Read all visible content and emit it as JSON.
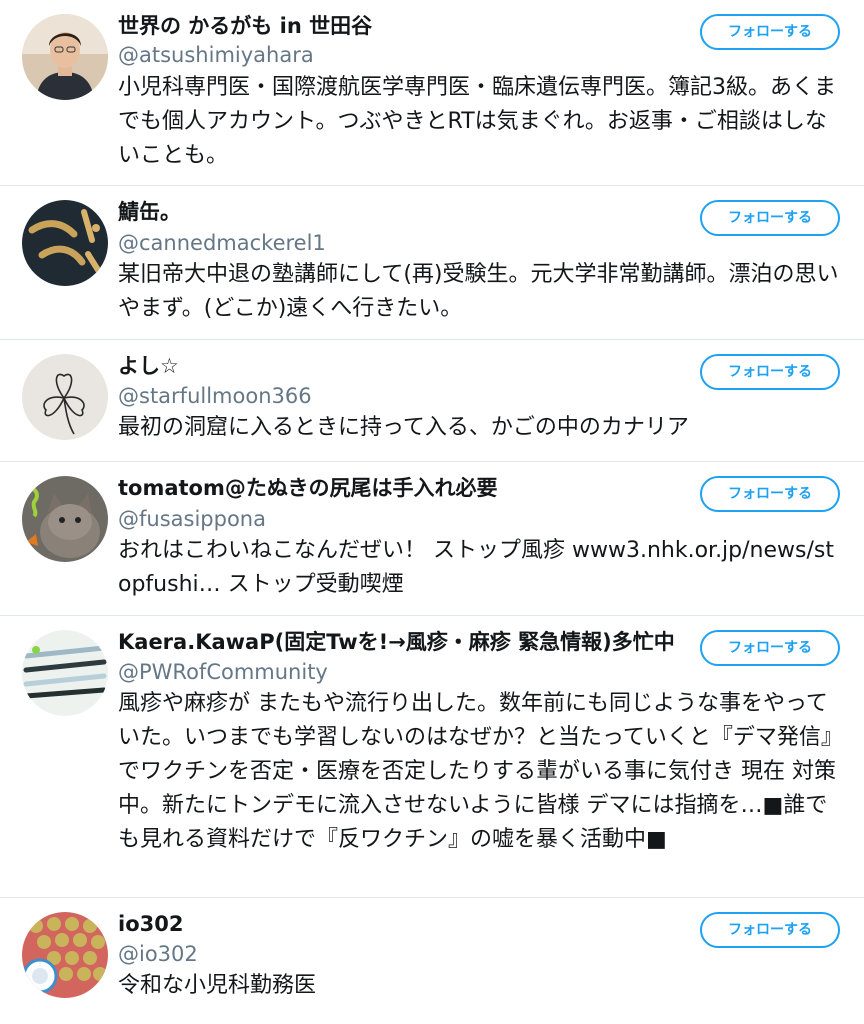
{
  "follow_label": "フォローする",
  "accent_color": "#1da1f2",
  "users": [
    {
      "name": "世界の かるがも in 世田谷",
      "handle": "@atsushimiyahara",
      "bio": "小児科専門医・国際渡航医学専門医・臨床遺伝専門医。簿記3級。あくまでも個人アカウント。つぶやきとRTは気まぐれ。お返事・ご相談はしないことも。",
      "avatar": "person-photo"
    },
    {
      "name": "鯖缶。",
      "handle": "@cannedmackerel1",
      "bio": "某旧帝大中退の塾講師にして(再)受験生。元大学非常勤講師。漂泊の思いやまず。(どこか)遠くへ行きたい。",
      "avatar": "calligraphy-image"
    },
    {
      "name": "よし☆",
      "handle": "@starfullmoon366",
      "bio": "最初の洞窟に入るときに持って入る、かごの中のカナリア",
      "avatar": "clover-drawing"
    },
    {
      "name": "tomatom@たぬきの尻尾は手入れ必要",
      "handle": "@fusasippona",
      "bio": "おれはこわいねこなんだぜい！ ストップ風疹 www3.nhk.or.jp/news/stopfushi… ストップ受動喫煙",
      "avatar": "cat-photo"
    },
    {
      "name": "Kaera.KawaP(固定Twを!→風疹・麻疹 緊急情報)多忙中",
      "handle": "@PWRofCommunity",
      "bio": "風疹や麻疹が またもや流行り出した。数年前にも同じような事をやっていた。いつまでも学習しないのはなぜか？と当たっていくと『デマ発信』でワクチンを否定・医療を否定したりする輩がいる事に気付き 現在 対策中。新たにトンデモに流入させないように皆様 デマには指摘を…■誰でも見れる資料だけで『反ワクチン』の嘘を暴く活動中■",
      "avatar": "pens-photo"
    },
    {
      "name": "io302",
      "handle": "@io302",
      "bio": "令和な小児科勤務医",
      "avatar": "cookies-photo"
    }
  ]
}
